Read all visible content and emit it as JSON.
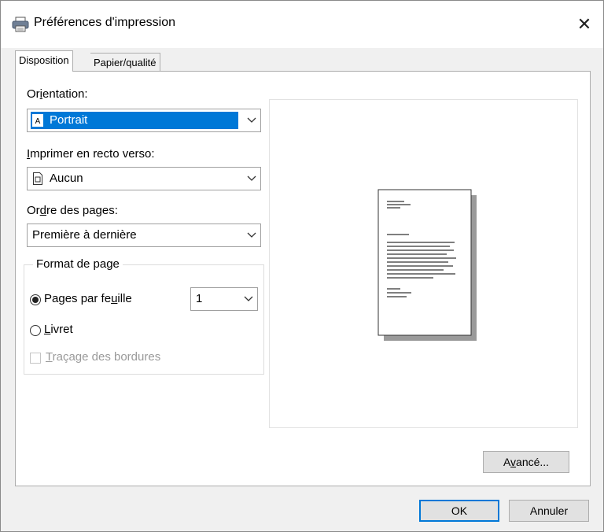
{
  "window": {
    "title": "Préférences d'impression",
    "close_symbol": "✕",
    "icon": "printer-icon"
  },
  "tabs": [
    {
      "label": "Disposition",
      "active": true
    },
    {
      "label": "Papier/qualité",
      "active": false
    }
  ],
  "orientation": {
    "label": "Orientation:",
    "value": "Portrait",
    "icon": "portrait-doc-icon"
  },
  "duplex": {
    "label": "Imprimer en recto verso:",
    "value": "Aucun",
    "icon": "document-icon"
  },
  "page_order": {
    "label": "Ordre des pages:",
    "value": "Première à dernière"
  },
  "page_format": {
    "title": "Format de page",
    "pages_per_sheet": {
      "label": "Pages par feuille",
      "checked": true,
      "value": "1"
    },
    "booklet": {
      "label": "Livret",
      "checked": false
    },
    "borders": {
      "label": "Traçage des bordures",
      "checked": false,
      "disabled": true
    }
  },
  "buttons": {
    "advanced": "Avancé...",
    "ok": "OK",
    "cancel": "Annuler"
  },
  "colors": {
    "selection": "#0078d7",
    "dialog_bg": "#f0f0f0",
    "panel_bg": "#ffffff"
  }
}
